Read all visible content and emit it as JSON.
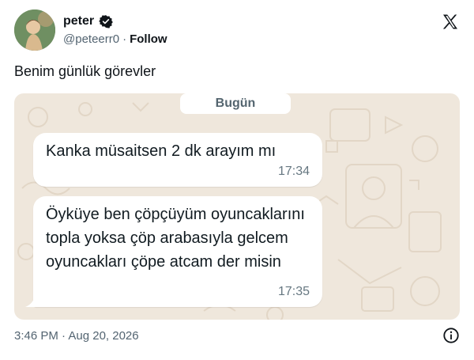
{
  "user": {
    "name": "peter",
    "handle": "@peteerr0",
    "separator": "·",
    "follow_label": "Follow"
  },
  "tweet": {
    "text": "Benim günlük görevler"
  },
  "chat": {
    "date_label": "Bugün",
    "messages": [
      {
        "text": "Kanka müsaitsen 2 dk arayım mı",
        "time": "17:34"
      },
      {
        "text": "Öyküye ben çöpçüyüm oyuncaklarını topla yoksa çöp arabasıyla gelcem oyuncakları çöpe atcam der misin",
        "time": "17:35"
      }
    ]
  },
  "footer": {
    "timestamp": "3:46 PM · Aug 20, 2026"
  },
  "icons": {
    "verified": "verified-badge-icon",
    "x_logo": "x-logo-icon",
    "info": "info-icon"
  },
  "colors": {
    "chat_background": "#efe7dc",
    "bubble": "#ffffff",
    "secondary_text": "#536471"
  }
}
